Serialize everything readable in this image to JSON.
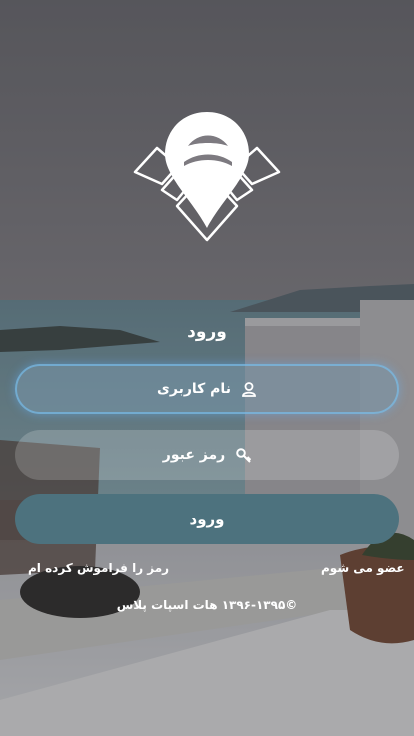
{
  "login": {
    "title": "ورود",
    "username_placeholder": "نام کاربری",
    "password_placeholder": "رمز عبور",
    "submit_label": "ورود",
    "join_link": "عضو می شوم",
    "forgot_link": "رمز را فراموش کرده ام",
    "copyright": "©۱۳۹۶-۱۳۹۵ هات اسپات پلاس"
  },
  "icons": {
    "logo": "hotspot-pin-wifi-logo",
    "username": "user-icon",
    "password": "key-icon"
  },
  "colors": {
    "button": "#4d727e",
    "accent_glow": "#78c8ff"
  }
}
